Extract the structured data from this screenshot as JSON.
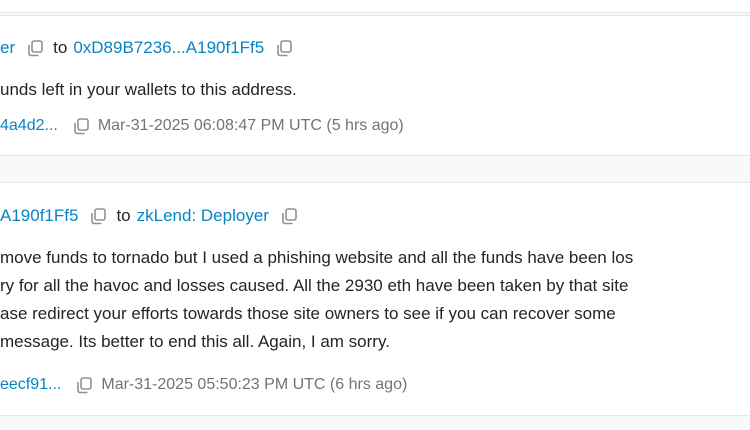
{
  "messages": [
    {
      "from": "er",
      "to_word": "to",
      "to": "0xD89B7236...A190f1Ff5",
      "text_lines": [
        "unds left in your wallets to this address."
      ],
      "tx_hash": "4a4d2...",
      "timestamp": "Mar-31-2025 06:08:47 PM UTC (5 hrs ago)"
    },
    {
      "from": "A190f1Ff5",
      "to_word": "to",
      "to": "zkLend: Deployer",
      "text_lines": [
        "move funds to tornado but I used a phishing website and all the funds have been los",
        "ry for all the havoc and losses caused. All the 2930 eth have been taken by that site",
        "ase redirect your efforts towards those site owners to see if you can recover some",
        "message. Its better to end this all. Again, I am sorry."
      ],
      "tx_hash": "eecf91...",
      "timestamp": "Mar-31-2025 05:50:23 PM UTC (6 hrs ago)"
    }
  ],
  "colors": {
    "link": "#0784c3",
    "text": "#212529",
    "muted": "#6c757d",
    "background": "#f8f9fa",
    "card": "#ffffff",
    "border": "#e3e6ea"
  },
  "icons": {
    "copy": "copy-icon"
  }
}
